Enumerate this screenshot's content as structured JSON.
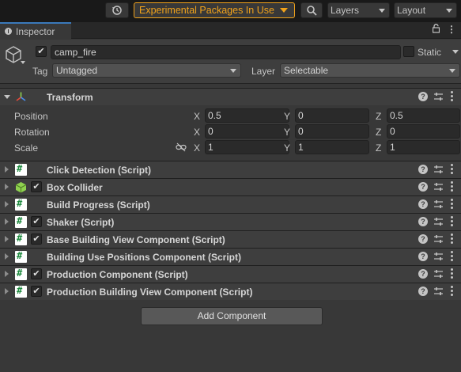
{
  "toolbar": {
    "experimental_label": "Experimental Packages In Use",
    "layers_label": "Layers",
    "layout_label": "Layout",
    "accent_color": "#f0a21b"
  },
  "tab": {
    "label": "Inspector",
    "icon": "info-icon",
    "actions": [
      "lock-icon",
      "menu-icon"
    ]
  },
  "object": {
    "active": true,
    "name": "camp_fire",
    "static_label": "Static",
    "static": false,
    "tag_label": "Tag",
    "tag_value": "Untagged",
    "layer_label": "Layer",
    "layer_value": "Selectable"
  },
  "transform": {
    "title": "Transform",
    "rows": [
      {
        "label": "Position",
        "x": "0.5",
        "y": "0",
        "z": "0.5"
      },
      {
        "label": "Rotation",
        "x": "0",
        "y": "0",
        "z": "0"
      },
      {
        "label": "Scale",
        "x": "1",
        "y": "1",
        "z": "1"
      }
    ],
    "axis_labels": [
      "X",
      "Y",
      "Z"
    ]
  },
  "components": [
    {
      "title": "Click Detection (Script)",
      "icon": "script-icon",
      "checkbox": false
    },
    {
      "title": "Box Collider",
      "icon": "box-collider-icon",
      "checkbox": true
    },
    {
      "title": "Build Progress (Script)",
      "icon": "script-icon",
      "checkbox": false
    },
    {
      "title": "Shaker (Script)",
      "icon": "script-icon",
      "checkbox": true
    },
    {
      "title": "Base Building View Component (Script)",
      "icon": "script-icon",
      "checkbox": true
    },
    {
      "title": "Building Use Positions Component (Script)",
      "icon": "script-icon",
      "checkbox": false
    },
    {
      "title": "Production Component (Script)",
      "icon": "script-icon",
      "checkbox": true
    },
    {
      "title": "Production Building View Component (Script)",
      "icon": "script-icon",
      "checkbox": true
    }
  ],
  "add_component_label": "Add Component"
}
